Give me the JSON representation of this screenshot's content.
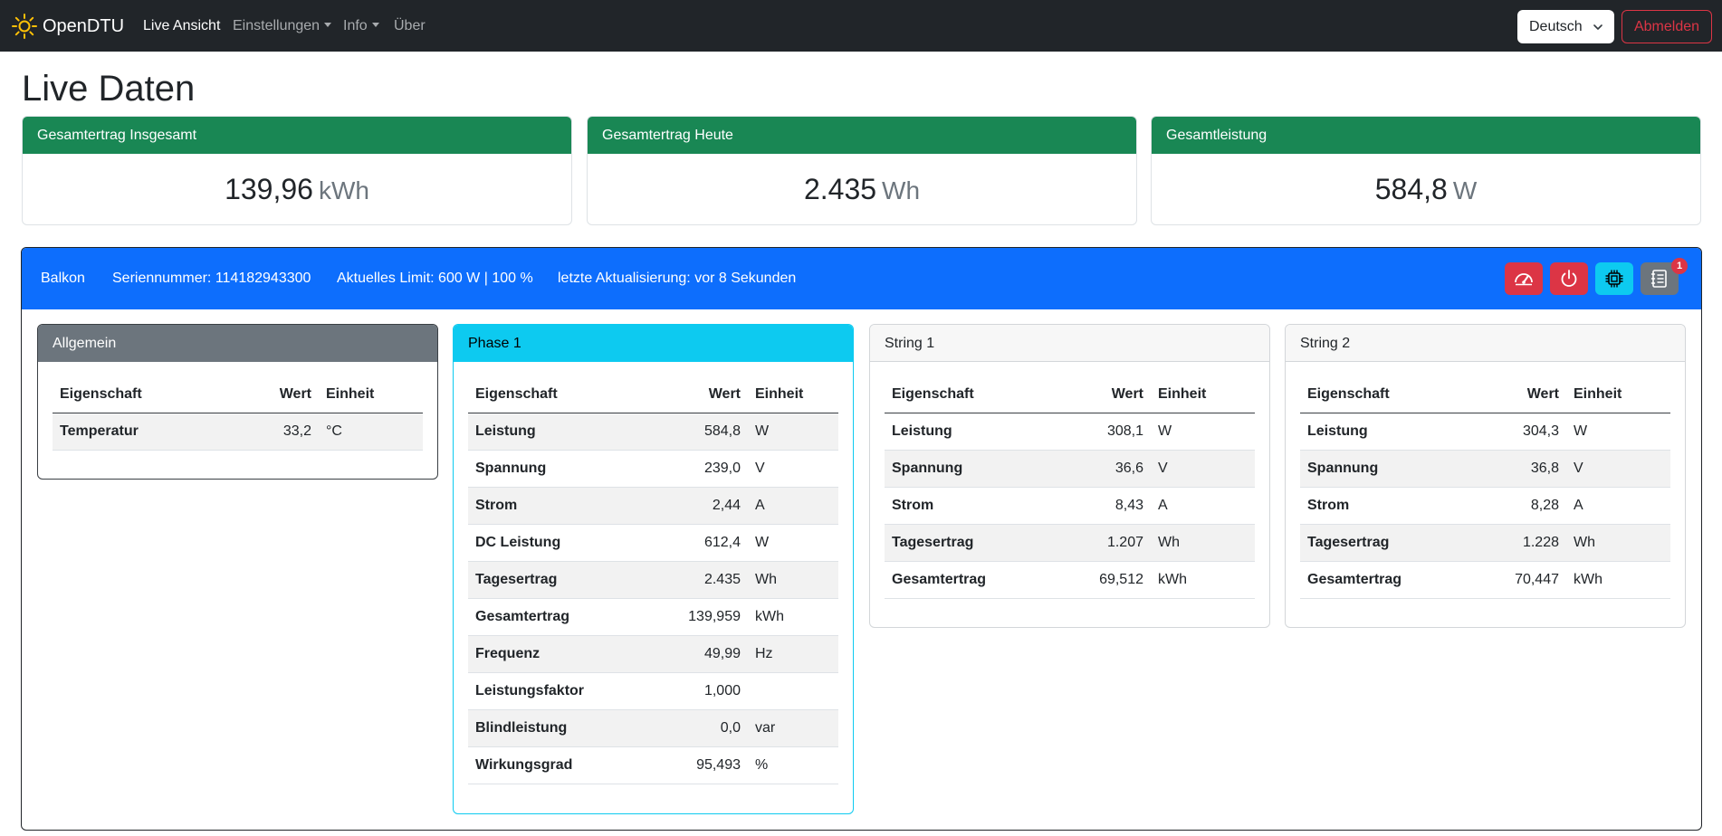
{
  "nav": {
    "brand": "OpenDTU",
    "links": [
      {
        "label": "Live Ansicht",
        "active": true,
        "dropdown": false
      },
      {
        "label": "Einstellungen",
        "active": false,
        "dropdown": true
      },
      {
        "label": "Info",
        "active": false,
        "dropdown": true
      },
      {
        "label": "Über",
        "active": false,
        "dropdown": false
      }
    ],
    "language": "Deutsch",
    "logout_label": "Abmelden"
  },
  "page": {
    "title": "Live Daten"
  },
  "totals": [
    {
      "label": "Gesamtertrag Insgesamt",
      "value": "139,96",
      "unit": "kWh"
    },
    {
      "label": "Gesamtertrag Heute",
      "value": "2.435",
      "unit": "Wh"
    },
    {
      "label": "Gesamtleistung",
      "value": "584,8",
      "unit": "W"
    }
  ],
  "inverter": {
    "name": "Balkon",
    "serial": "Seriennummer: 114182943300",
    "limit": "Aktuelles Limit: 600 W | 100 %",
    "updated": "letzte Aktualisierung: vor 8 Sekunden",
    "buttons": [
      {
        "icon": "speedometer-icon",
        "color": "#dc3545"
      },
      {
        "icon": "power-icon",
        "color": "#dc3545"
      },
      {
        "icon": "cpu-icon",
        "color": "#0dcaf0"
      },
      {
        "icon": "event-log-icon",
        "color": "#6c757d"
      }
    ],
    "event_badge": "1"
  },
  "table_headers": {
    "property": "Eigenschaft",
    "value": "Wert",
    "unit": "Einheit"
  },
  "channels": [
    {
      "title": "Allgemein",
      "rows": [
        {
          "property": "Temperatur",
          "value": "33,2",
          "unit": "°C"
        }
      ]
    },
    {
      "title": "Phase 1",
      "rows": [
        {
          "property": "Leistung",
          "value": "584,8",
          "unit": "W"
        },
        {
          "property": "Spannung",
          "value": "239,0",
          "unit": "V"
        },
        {
          "property": "Strom",
          "value": "2,44",
          "unit": "A"
        },
        {
          "property": "DC Leistung",
          "value": "612,4",
          "unit": "W"
        },
        {
          "property": "Tagesertrag",
          "value": "2.435",
          "unit": "Wh"
        },
        {
          "property": "Gesamtertrag",
          "value": "139,959",
          "unit": "kWh"
        },
        {
          "property": "Frequenz",
          "value": "49,99",
          "unit": "Hz"
        },
        {
          "property": "Leistungsfaktor",
          "value": "1,000",
          "unit": ""
        },
        {
          "property": "Blindleistung",
          "value": "0,0",
          "unit": "var"
        },
        {
          "property": "Wirkungsgrad",
          "value": "95,493",
          "unit": "%"
        }
      ]
    },
    {
      "title": "String 1",
      "rows": [
        {
          "property": "Leistung",
          "value": "308,1",
          "unit": "W"
        },
        {
          "property": "Spannung",
          "value": "36,6",
          "unit": "V"
        },
        {
          "property": "Strom",
          "value": "8,43",
          "unit": "A"
        },
        {
          "property": "Tagesertrag",
          "value": "1.207",
          "unit": "Wh"
        },
        {
          "property": "Gesamtertrag",
          "value": "69,512",
          "unit": "kWh"
        }
      ]
    },
    {
      "title": "String 2",
      "rows": [
        {
          "property": "Leistung",
          "value": "304,3",
          "unit": "W"
        },
        {
          "property": "Spannung",
          "value": "36,8",
          "unit": "V"
        },
        {
          "property": "Strom",
          "value": "8,28",
          "unit": "A"
        },
        {
          "property": "Tagesertrag",
          "value": "1.228",
          "unit": "Wh"
        },
        {
          "property": "Gesamtertrag",
          "value": "70,447",
          "unit": "kWh"
        }
      ]
    }
  ],
  "colors": {
    "navbar": "#212529",
    "success": "#198754",
    "primary": "#0d6efd",
    "info": "#0dcaf0",
    "secondary": "#6c757d",
    "danger": "#dc3545"
  }
}
